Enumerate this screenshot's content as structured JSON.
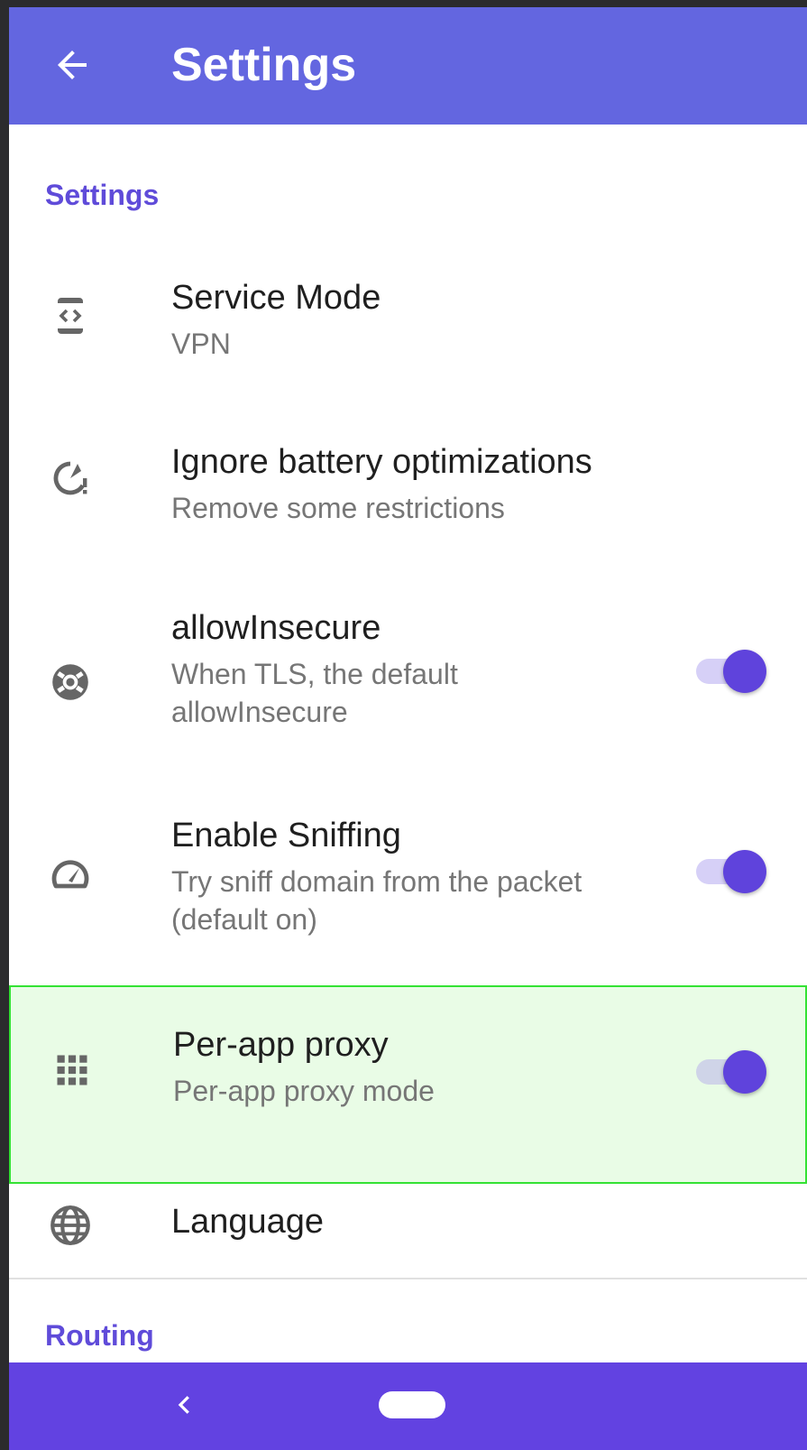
{
  "appbar": {
    "title": "Settings",
    "back_icon": "arrow-left-icon"
  },
  "section_settings": {
    "label": "Settings"
  },
  "items": [
    {
      "title": "Service Mode",
      "subtitle": "VPN",
      "icon": "service-mode-icon"
    },
    {
      "title": "Ignore battery optimizations",
      "subtitle": "Remove some restrictions",
      "icon": "battery-alert-icon"
    },
    {
      "title": "allowInsecure",
      "subtitle": "When TLS, the default allowInsecure",
      "icon": "lifebuoy-icon",
      "toggle": true
    },
    {
      "title": "Enable Sniffing",
      "subtitle": "Try sniff domain from the packet (default on)",
      "icon": "speedometer-icon",
      "toggle": true
    },
    {
      "title": "Per-app proxy",
      "subtitle": "Per-app proxy mode",
      "icon": "apps-grid-icon",
      "toggle": true
    },
    {
      "title": "Language",
      "icon": "globe-icon"
    }
  ],
  "section_routing": {
    "label": "Routing"
  },
  "colors": {
    "appbar": "#6366e0",
    "accent": "#5f4bd9",
    "navbar": "#6242e1",
    "highlight": "#e9fce6"
  }
}
